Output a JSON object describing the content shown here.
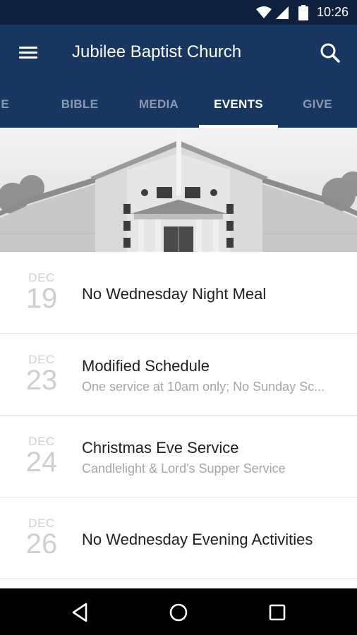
{
  "status_bar": {
    "time": "10:26",
    "icons": [
      "wifi-icon",
      "signal-icon",
      "battery-icon"
    ]
  },
  "app_bar": {
    "title": "Jubilee Baptist Church",
    "menu_icon": "hamburger-menu-icon",
    "search_icon": "search-icon"
  },
  "tabs": [
    {
      "label": "ME"
    },
    {
      "label": "BIBLE"
    },
    {
      "label": "MEDIA"
    },
    {
      "label": "EVENTS",
      "active": true
    },
    {
      "label": "GIVE"
    }
  ],
  "hero": {
    "description": "church-building-photo"
  },
  "events": [
    {
      "month": "DEC",
      "day": "19",
      "title": "No Wednesday Night Meal",
      "subtitle": ""
    },
    {
      "month": "DEC",
      "day": "23",
      "title": "Modified Schedule",
      "subtitle": "One service at 10am only; No Sunday Sc..."
    },
    {
      "month": "DEC",
      "day": "24",
      "title": "Christmas Eve Service",
      "subtitle": "Candlelight & Lord's Supper Service"
    },
    {
      "month": "DEC",
      "day": "26",
      "title": "No Wednesday Evening Activities",
      "subtitle": ""
    }
  ],
  "nav_bar": {
    "buttons": [
      "back-icon",
      "home-icon",
      "recents-icon"
    ]
  },
  "colors": {
    "status_bar": "#0d213f",
    "app_bar": "#183760",
    "tab_inactive": "#8a9ab3",
    "tab_active": "#ffffff",
    "date_text": "#d0d0d0",
    "title_text": "#202020",
    "subtitle_text": "#a6a6a6"
  }
}
